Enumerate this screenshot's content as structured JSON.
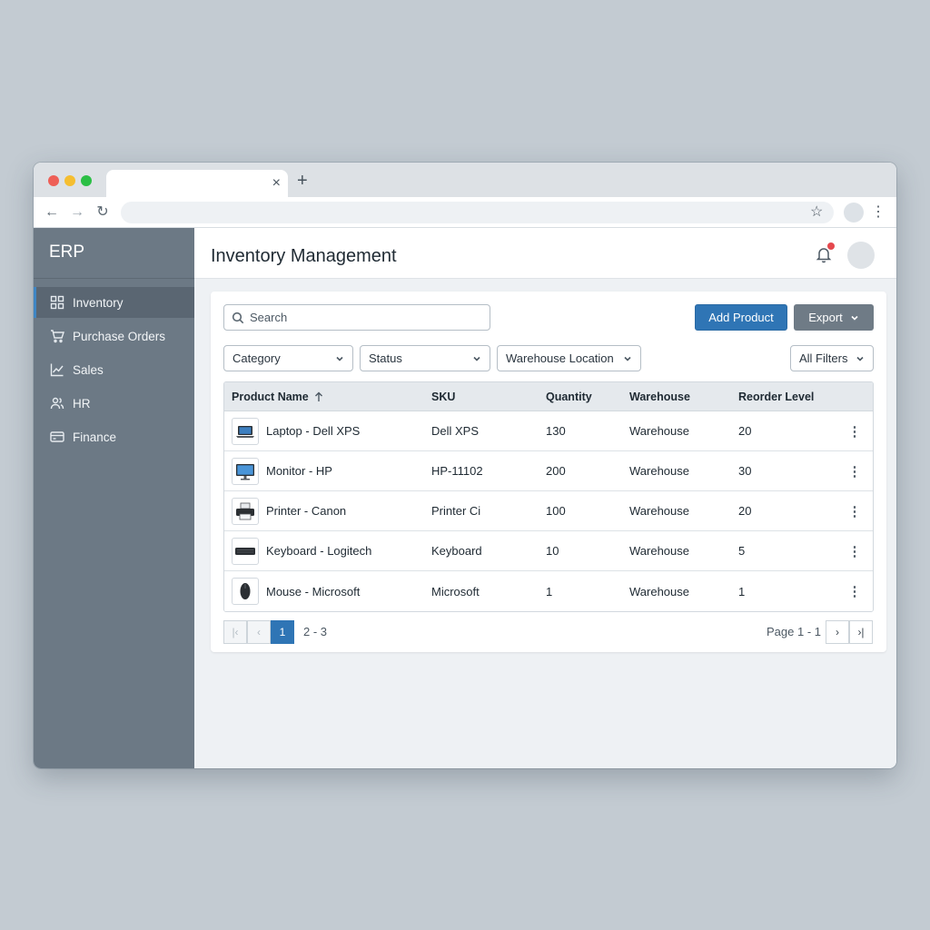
{
  "app": {
    "brand": "ERP"
  },
  "browser": {
    "tab_close": "×",
    "new_tab": "+"
  },
  "sidebar": {
    "items": [
      {
        "label": "Inventory",
        "icon": "grid-icon",
        "active": true
      },
      {
        "label": "Purchase Orders",
        "icon": "cart-icon",
        "active": false
      },
      {
        "label": "Sales",
        "icon": "chart-icon",
        "active": false
      },
      {
        "label": "HR",
        "icon": "users-icon",
        "active": false
      },
      {
        "label": "Finance",
        "icon": "credit-card-icon",
        "active": false
      }
    ]
  },
  "header": {
    "title": "Inventory Management",
    "notification_badge_color": "#e5484d"
  },
  "toolbar": {
    "search_placeholder": "Search",
    "add_label": "Add Product",
    "export_label": "Export"
  },
  "filters": {
    "category": "Category",
    "status": "Status",
    "warehouse": "Warehouse Location",
    "all": "All Filters"
  },
  "table": {
    "columns": {
      "name": "Product Name",
      "sku": "SKU",
      "quantity": "Quantity",
      "warehouse": "Warehouse",
      "reorder": "Reorder Level"
    },
    "rows": [
      {
        "name": "Laptop - Dell XPS",
        "sku": "Dell XPS",
        "quantity": "130",
        "warehouse": "Warehouse",
        "reorder": "20",
        "icon": "laptop-icon"
      },
      {
        "name": "Monitor - HP",
        "sku": "HP-11102",
        "quantity": "200",
        "warehouse": "Warehouse",
        "reorder": "30",
        "icon": "monitor-icon"
      },
      {
        "name": "Printer - Canon",
        "sku": "Printer Ci",
        "quantity": "100",
        "warehouse": "Warehouse",
        "reorder": "20",
        "icon": "printer-icon"
      },
      {
        "name": "Keyboard - Logitech",
        "sku": "Keyboard",
        "quantity": "10",
        "warehouse": "Warehouse",
        "reorder": "5",
        "icon": "keyboard-icon"
      },
      {
        "name": "Mouse - Microsoft",
        "sku": "Microsoft",
        "quantity": "1",
        "warehouse": "Warehouse",
        "reorder": "1",
        "icon": "mouse-icon"
      }
    ]
  },
  "pagination": {
    "current": "1",
    "range": "2 - 3",
    "info": "Page 1 - 1"
  },
  "colors": {
    "accent": "#2f75b5",
    "sidebar": "#6c7985"
  }
}
